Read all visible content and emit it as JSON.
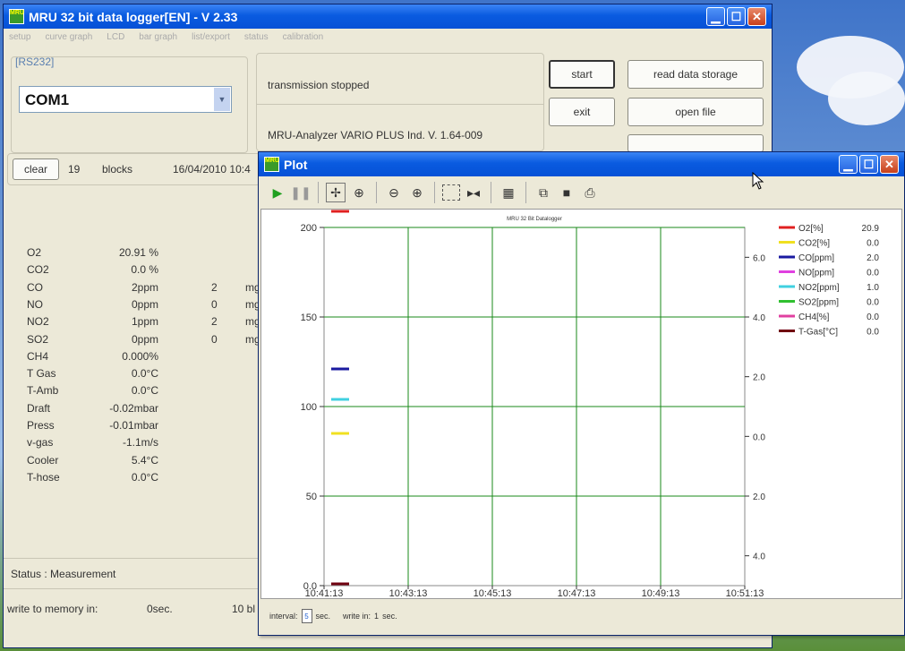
{
  "main_window": {
    "title": "MRU 32 bit data logger[EN] - V 2.33",
    "menu": [
      "setup",
      "curve graph",
      "LCD",
      "bar graph",
      "list/export",
      "status",
      "calibration"
    ],
    "port_group_label": "[RS232]",
    "port_value": "COM1",
    "transmission_status": "transmission stopped",
    "analyzer_info": "MRU-Analyzer VARIO PLUS Ind.   V. 1.64-009",
    "buttons": {
      "start": "start",
      "exit": "exit",
      "read_data_storage": "read data storage",
      "open_file": "open file"
    },
    "clear_label": "clear",
    "blocks_count": "19",
    "blocks_label": "blocks",
    "timestamp": "16/04/2010 10:4",
    "measurements": [
      {
        "name": "O2",
        "value": "20.91 %",
        "extra": "",
        "unit2": ""
      },
      {
        "name": "CO2",
        "value": "0.0 %",
        "extra": "",
        "unit2": ""
      },
      {
        "name": "CO",
        "value": "2ppm",
        "extra": "2",
        "unit2": "mg"
      },
      {
        "name": "NO",
        "value": "0ppm",
        "extra": "0",
        "unit2": "mg"
      },
      {
        "name": "NO2",
        "value": "1ppm",
        "extra": "2",
        "unit2": "mg"
      },
      {
        "name": "SO2",
        "value": "0ppm",
        "extra": "0",
        "unit2": "mg"
      },
      {
        "name": "CH4",
        "value": "0.000%",
        "extra": "",
        "unit2": ""
      },
      {
        "name": "T Gas",
        "value": "0.0°C",
        "extra": "",
        "unit2": ""
      },
      {
        "name": "T-Amb",
        "value": "0.0°C",
        "extra": "",
        "unit2": ""
      },
      {
        "name": "Draft",
        "value": "-0.02mbar",
        "extra": "",
        "unit2": ""
      },
      {
        "name": "Press",
        "value": "-0.01mbar",
        "extra": "",
        "unit2": ""
      },
      {
        "name": "v-gas",
        "value": "-1.1m/s",
        "extra": "",
        "unit2": ""
      },
      {
        "name": "Cooler",
        "value": "5.4°C",
        "extra": "",
        "unit2": ""
      },
      {
        "name": "T-hose",
        "value": "0.0°C",
        "extra": "",
        "unit2": ""
      }
    ],
    "status_text": "Status : Measurement",
    "write_memory_label": "write to memory  in:",
    "write_memory_value": "0sec.",
    "write_memory_blocks": "10  bl"
  },
  "plot_window": {
    "title": "Plot",
    "status": {
      "interval_label": "interval:",
      "interval_value": "5",
      "sec_label": "sec.",
      "write_in_label": "write in:",
      "write_in_value": "1",
      "sec_label2": "sec."
    }
  },
  "chart_data": {
    "type": "line",
    "title": "MRU 32 Bit Datalogger",
    "x_ticks": [
      "10:41:13",
      "10:43:13",
      "10:45:13",
      "10:47:13",
      "10:49:13",
      "10:51:13"
    ],
    "y_left": {
      "range": [
        0,
        200
      ],
      "ticks": [
        "0.0",
        "50",
        "100",
        "150",
        "200"
      ]
    },
    "y_right": {
      "range": [
        -5,
        7
      ],
      "ticks": [
        "4.0",
        "2.0",
        "0.0",
        "2.0",
        "4.0",
        "6.0"
      ]
    },
    "grid": true,
    "legend_position": "right",
    "series": [
      {
        "name": "O2[%]",
        "value": "20.9",
        "color": "#e02020",
        "y": 209
      },
      {
        "name": "CO2[%]",
        "value": "0.0",
        "color": "#f0e020",
        "y": 85
      },
      {
        "name": "CO[ppm]",
        "value": "2.0",
        "color": "#1a1aa0",
        "y": 121
      },
      {
        "name": "NO[ppm]",
        "value": "0.0",
        "color": "#e040e0",
        "y": 0
      },
      {
        "name": "NO2[ppm]",
        "value": "1.0",
        "color": "#40d0e0",
        "y": 104
      },
      {
        "name": "SO2[ppm]",
        "value": "0.0",
        "color": "#30c030",
        "y": 0
      },
      {
        "name": "CH4[%]",
        "value": "0.0",
        "color": "#e040a0",
        "y": 0
      },
      {
        "name": "T-Gas[°C]",
        "value": "0.0",
        "color": "#700010",
        "y": 0
      }
    ]
  }
}
